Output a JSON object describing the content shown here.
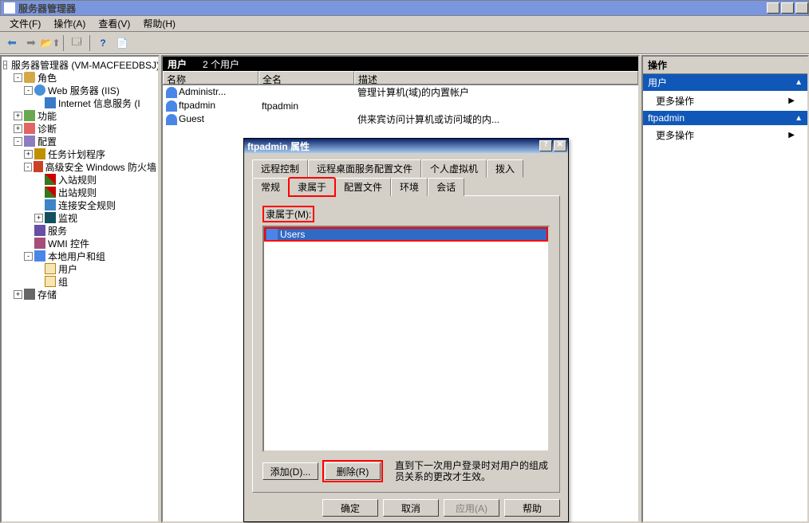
{
  "window": {
    "title": "服务器管理器"
  },
  "menubar": {
    "file": "文件(F)",
    "action": "操作(A)",
    "view": "查看(V)",
    "help": "帮助(H)"
  },
  "tree": {
    "root": "服务器管理器 (VM-MACFEEDBSJ)",
    "roles": "角色",
    "web": "Web 服务器 (IIS)",
    "iis": "Internet 信息服务 (I",
    "features": "功能",
    "diagnostics": "诊断",
    "configuration": "配置",
    "task_scheduler": "任务计划程序",
    "firewall": "高级安全 Windows 防火墙",
    "inbound": "入站规则",
    "outbound": "出站规则",
    "connsec": "连接安全规则",
    "monitor": "监视",
    "services": "服务",
    "wmi": "WMI 控件",
    "local_ug": "本地用户和组",
    "users": "用户",
    "groups": "组",
    "storage": "存储"
  },
  "list": {
    "header_title": "用户",
    "header_count": "2 个用户",
    "col_name": "名称",
    "col_fullname": "全名",
    "col_desc": "描述",
    "rows": [
      {
        "name": "Administr...",
        "fullname": "",
        "desc": "管理计算机(域)的内置帐户"
      },
      {
        "name": "ftpadmin",
        "fullname": "ftpadmin",
        "desc": ""
      },
      {
        "name": "Guest",
        "fullname": "",
        "desc": "供来宾访问计算机或访问域的内..."
      }
    ]
  },
  "actions": {
    "title": "操作",
    "section1": "用户",
    "more1": "更多操作",
    "section2": "ftpadmin",
    "more2": "更多操作"
  },
  "dialog": {
    "title": "ftpadmin 属性",
    "tabs_r1": [
      "远程控制",
      "远程桌面服务配置文件",
      "个人虚拟机",
      "拨入"
    ],
    "tabs_r2": [
      "常规",
      "隶属于",
      "配置文件",
      "环境",
      "会话"
    ],
    "memberof_label": "隶属于(M):",
    "groups": [
      "Users"
    ],
    "btn_add": "添加(D)...",
    "btn_remove": "删除(R)",
    "hint": "直到下一次用户登录时对用户的组成员关系的更改才生效。",
    "btn_ok": "确定",
    "btn_cancel": "取消",
    "btn_apply": "应用(A)",
    "btn_help": "帮助"
  }
}
